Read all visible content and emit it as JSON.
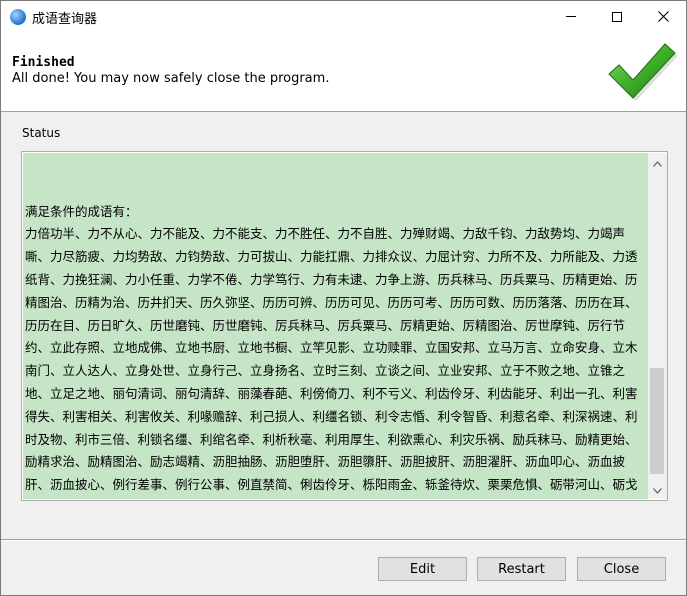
{
  "window": {
    "title": "成语查询器"
  },
  "header": {
    "title": "Finished",
    "subtitle": "All done! You may now safely close the program."
  },
  "status": {
    "label": "Status",
    "lines": [
      "满足条件的成语有：",
      "力倍功半、力不从心、力不能及、力不能支、力不胜任、力不自胜、力殚财竭、力敌千钧、力敌势均、力竭声嘶、力尽筋疲、力均势敌、力钧势敌、力可拔山、力能扛鼎、力排众议、力屈计穷、力所不及、力所能及、力透纸背、力挽狂澜、力小任重、力学不倦、力学笃行、力有未逮、力争上游、历兵秣马、历兵粟马、历精更始、历精图治、历精为治、历井扪天、历久弥坚、历历可辨、历历可见、历历可考、历历可数、历历落落、历历在耳、历历在目、历日旷久、历世磨钝、历世磨钝、厉兵秣马、厉兵粟马、厉精更始、厉精图治、厉世摩钝、厉行节约、立此存照、立地成佛、立地书厨、立地书橱、立竿见影、立功赎罪、立国安邦、立马万言、立命安身、立木南门、立人达人、立身处世、立身行己、立身扬名、立时三刻、立谈之间、立业安邦、立于不败之地、立锥之地、立足之地、丽句清词、丽句清辞、丽藻春葩、利傍倚刀、利不亏义、利齿伶牙、利齿能牙、利出一孔、利害得失、利害相关、利害攸关、利喙赡辞、利己损人、利缰名锁、利令志惛、利令智昏、利惹名牵、利深祸速、利时及物、利市三倍、利锁名缰、利绾名牵、利析秋毫、利用厚生、利欲熏心、利灾乐祸、励兵秣马、励精更始、励精求治、励精图治、励志竭精、沥胆抽肠、沥胆堕肝、沥胆隳肝、沥胆披肝、沥胆濯肝、沥血叩心、沥血披肝、沥血披心、例行差事、例行公事、例直禁简、俐齿伶牙、栎阳雨金、轹釜待炊、栗栗危惧、砺带河山、砺戈秣马、砺山带河、砺世摩钝、砺世磨钝、砺岳盟河、粒米狼戾、粒米束薪、粝食粗衣、詈夷为跖"
    ],
    "separator": "------------------------------------------------------------------------"
  },
  "buttons": {
    "edit": "Edit",
    "restart": "Restart",
    "close": "Close"
  },
  "icons": {
    "app": "app-globe-icon",
    "finished": "green-checkmark-icon",
    "minimize": "minimize-icon",
    "maximize": "maximize-icon",
    "close": "close-icon",
    "scroll_up": "chevron-up-icon",
    "scroll_down": "chevron-down-icon"
  },
  "colors": {
    "status_background": "#c6e5c7",
    "check_green": "#3fae2a"
  }
}
